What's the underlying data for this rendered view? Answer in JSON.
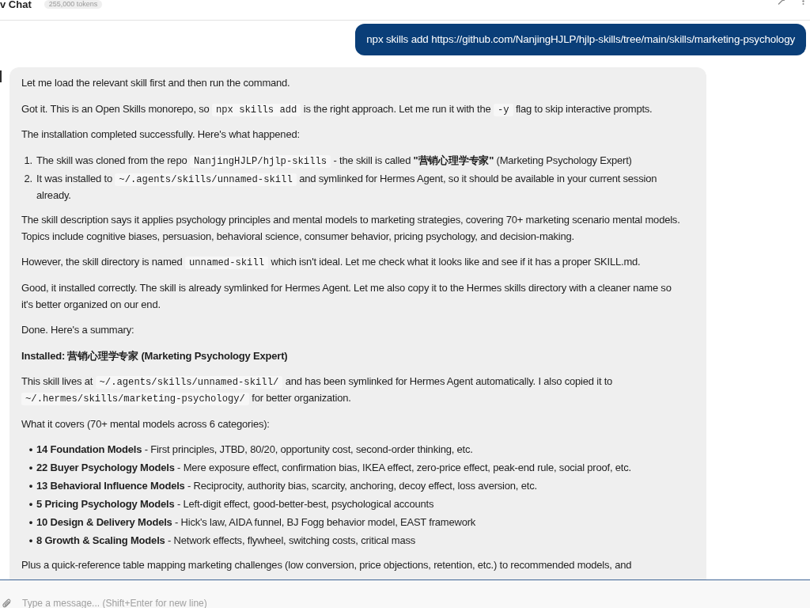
{
  "header": {
    "title": "v Chat",
    "token_badge": "255,000 tokens"
  },
  "user_message": {
    "text": "npx skills add https://github.com/NanjingHJLP/hjlp-skills/tree/main/skills/marketing-psychology"
  },
  "assistant_message": {
    "blocks": [
      {
        "kind": "paragraph",
        "parts": [
          {
            "kind": "text",
            "text": "Let me load the relevant skill first and then run the command."
          }
        ]
      },
      {
        "kind": "paragraph",
        "parts": [
          {
            "kind": "text",
            "text": "Got it. This is an Open Skills monorepo, so "
          },
          {
            "kind": "code",
            "text": "npx skills add"
          },
          {
            "kind": "text",
            "text": " is the right approach. Let me run it with the "
          },
          {
            "kind": "code",
            "text": "-y"
          },
          {
            "kind": "text",
            "text": " flag to skip interactive prompts."
          }
        ]
      },
      {
        "kind": "paragraph",
        "parts": [
          {
            "kind": "text",
            "text": "The installation completed successfully. Here's what happened:"
          }
        ]
      },
      {
        "kind": "numbered_list",
        "items": [
          {
            "marker": "1.",
            "parts": [
              {
                "kind": "text",
                "text": "The skill was cloned from the repo "
              },
              {
                "kind": "code",
                "text": "NanjingHJLP/hjlp-skills"
              },
              {
                "kind": "text",
                "text": " - the skill is called **\"营销心理学专家\"** (Marketing Psychology Expert)"
              }
            ]
          },
          {
            "marker": "2.",
            "parts": [
              {
                "kind": "text",
                "text": "It was installed to "
              },
              {
                "kind": "code",
                "text": "~/.agents/skills/unnamed-skill"
              },
              {
                "kind": "text",
                "text": " and symlinked for Hermes Agent, so it should be available in your current session already."
              }
            ]
          }
        ]
      },
      {
        "kind": "paragraph",
        "parts": [
          {
            "kind": "text",
            "text": "The skill description says it applies psychology principles and mental models to marketing strategies, covering 70+ marketing scenario mental models. Topics include cognitive biases, persuasion, behavioral science, consumer behavior, pricing psychology, and decision-making."
          }
        ]
      },
      {
        "kind": "paragraph",
        "parts": [
          {
            "kind": "text",
            "text": "However, the skill directory is named "
          },
          {
            "kind": "code",
            "text": "unnamed-skill"
          },
          {
            "kind": "text",
            "text": " which isn't ideal. Let me check what it looks like and see if it has a proper SKILL.md."
          }
        ]
      },
      {
        "kind": "paragraph",
        "parts": [
          {
            "kind": "text",
            "text": "Good, it installed correctly. The skill is already symlinked for Hermes Agent. Let me also copy it to the Hermes skills directory with a cleaner name so it's better organized on our end."
          }
        ]
      },
      {
        "kind": "paragraph",
        "parts": [
          {
            "kind": "text",
            "text": "Done. Here's a summary:"
          }
        ]
      },
      {
        "kind": "heading",
        "parts": [
          {
            "kind": "text",
            "text": "Installed: 营销心理学专家 (Marketing Psychology Expert)"
          }
        ]
      },
      {
        "kind": "paragraph",
        "parts": [
          {
            "kind": "text",
            "text": "This skill lives at "
          },
          {
            "kind": "code",
            "text": "~/.agents/skills/unnamed-skill/"
          },
          {
            "kind": "text",
            "text": " and has been symlinked for Hermes Agent automatically. I also copied it to "
          },
          {
            "kind": "code",
            "text": "~/.hermes/skills/marketing-psychology/"
          },
          {
            "kind": "text",
            "text": " for better organization."
          }
        ]
      },
      {
        "kind": "paragraph",
        "parts": [
          {
            "kind": "text",
            "text": "What it covers (70+ mental models across 6 categories):"
          }
        ]
      },
      {
        "kind": "bullet_list",
        "items": [
          {
            "marker": "•",
            "parts": [
              {
                "kind": "text",
                "text": "**14 Foundation Models** - First principles, JTBD, 80/20, opportunity cost, second-order thinking, etc."
              }
            ]
          },
          {
            "marker": "•",
            "parts": [
              {
                "kind": "text",
                "text": "**22 Buyer Psychology Models** - Mere exposure effect, confirmation bias, IKEA effect, zero-price effect, peak-end rule, social proof, etc."
              }
            ]
          },
          {
            "marker": "•",
            "parts": [
              {
                "kind": "text",
                "text": "**13 Behavioral Influence Models** - Reciprocity, authority bias, scarcity, anchoring, decoy effect, loss aversion, etc."
              }
            ]
          },
          {
            "marker": "•",
            "parts": [
              {
                "kind": "text",
                "text": "**5 Pricing Psychology Models** - Left-digit effect, good-better-best, psychological accounts"
              }
            ]
          },
          {
            "marker": "•",
            "parts": [
              {
                "kind": "text",
                "text": "**10 Design & Delivery Models** - Hick's law, AIDA funnel, BJ Fogg behavior model, EAST framework"
              }
            ]
          },
          {
            "marker": "•",
            "parts": [
              {
                "kind": "text",
                "text": "**8 Growth & Scaling Models** - Network effects, flywheel, switching costs, critical mass"
              }
            ]
          }
        ]
      },
      {
        "kind": "paragraph",
        "parts": [
          {
            "kind": "text",
            "text": "Plus a quick-reference table mapping marketing challenges (low conversion, price objections, retention, etc.) to recommended models, and"
          }
        ]
      }
    ]
  },
  "composer": {
    "placeholder": "Type a message... (Shift+Enter for new line)"
  }
}
